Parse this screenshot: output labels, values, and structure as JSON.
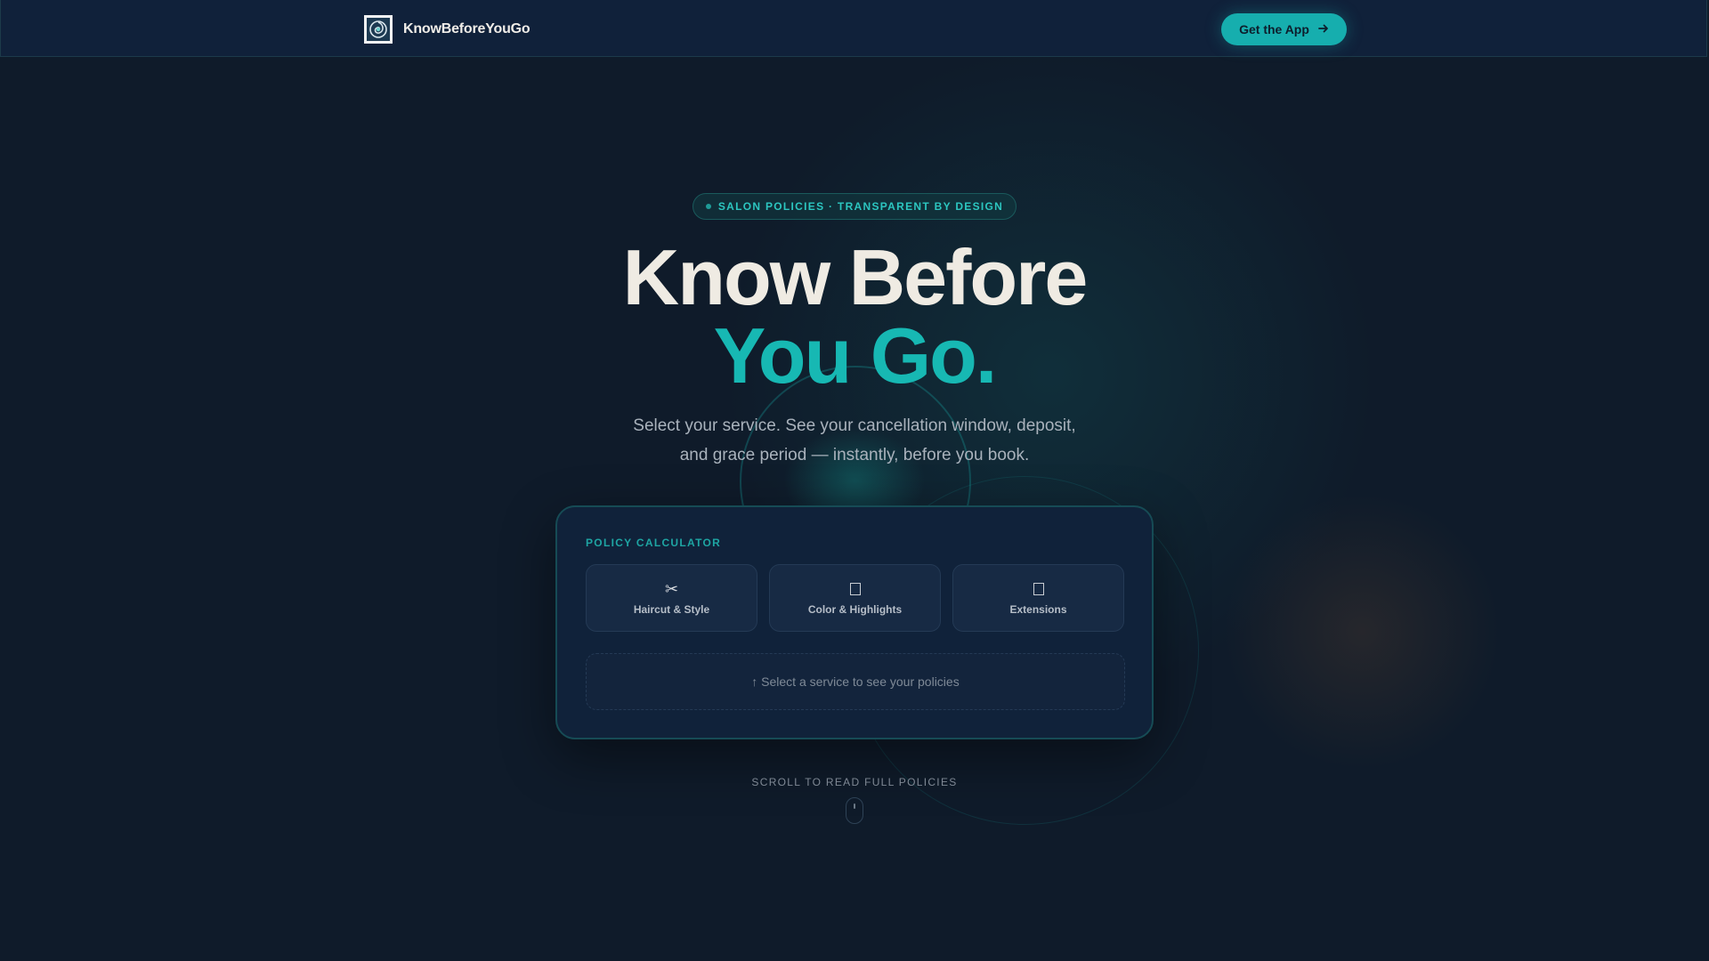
{
  "header": {
    "brand_name": "KnowBeforeYouGo",
    "logo_icon": "swirl-logo-icon",
    "cta_label": "Get the App",
    "cta_icon": "arrow-right-icon"
  },
  "hero": {
    "badge": "SALON POLICIES · TRANSPARENT BY DESIGN",
    "title_line1": "Know Before",
    "title_line2": "You Go.",
    "subtitle_line1": "Select your service. See your cancellation window, deposit,",
    "subtitle_line2": "and grace period — instantly, before you book."
  },
  "calculator": {
    "label": "POLICY CALCULATOR",
    "services": [
      {
        "label": "Haircut & Style",
        "icon": "scissors-icon"
      },
      {
        "label": "Color & Highlights",
        "icon": "palette-icon"
      },
      {
        "label": "Extensions",
        "icon": "extensions-icon"
      }
    ],
    "hint": "↑ Select a service to see your policies"
  },
  "scroll": {
    "label": "SCROLL TO READ FULL POLICIES",
    "icon": "mouse-scroll-icon"
  },
  "colors": {
    "background": "#0f1b2a",
    "accent": "#17b8b3",
    "header": "#10213a",
    "card": "#10223a"
  }
}
